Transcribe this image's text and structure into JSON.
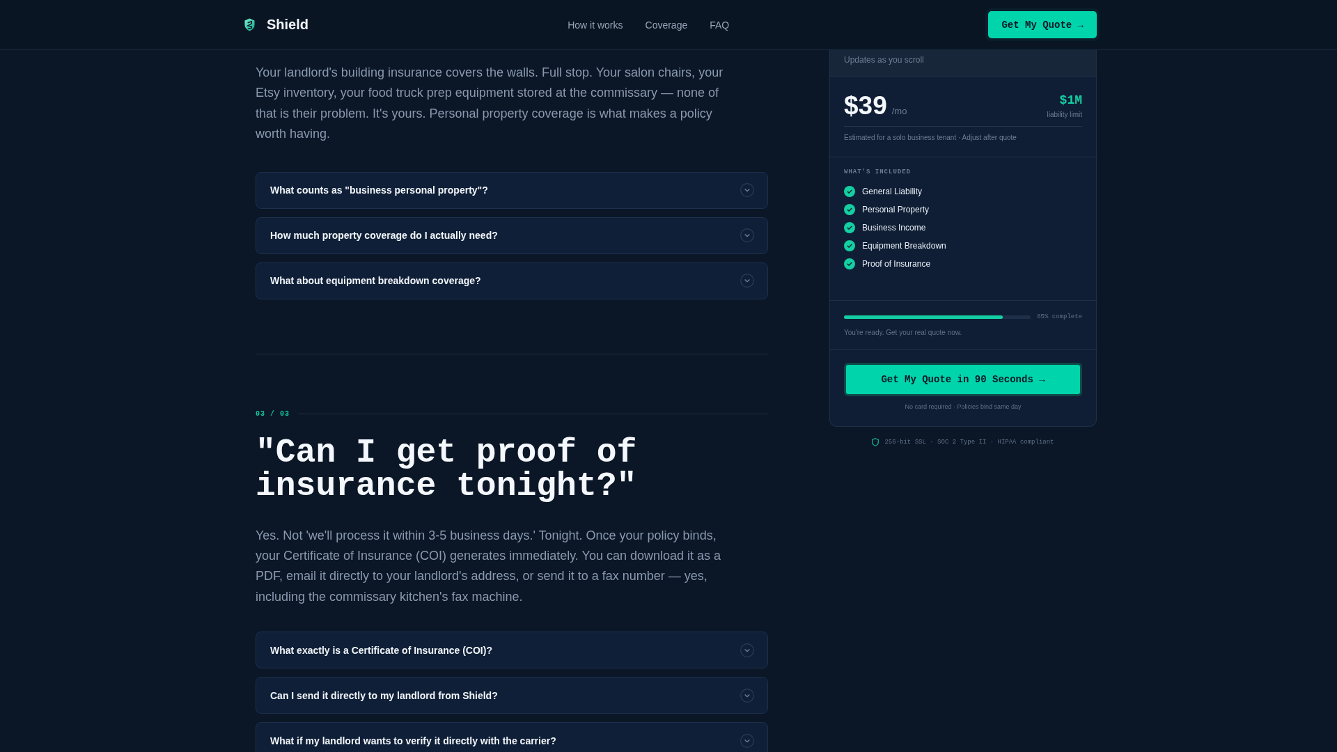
{
  "header": {
    "brand": "Shield",
    "nav": [
      {
        "label": "How it works"
      },
      {
        "label": "Coverage"
      },
      {
        "label": "FAQ"
      }
    ],
    "cta": "Get My Quote →"
  },
  "sections": [
    {
      "body": "Your landlord's building insurance covers the walls. Full stop. Your salon chairs, your Etsy inventory, your food truck prep equipment stored at the commissary — none of that is their problem. It's yours. Personal property coverage is what makes a policy worth having.",
      "faqs": [
        {
          "question": "What counts as \"business personal property\"?",
          "expanded": false
        },
        {
          "question": "How much property coverage do I actually need?",
          "expanded": false
        },
        {
          "question": "What about equipment breakdown coverage?",
          "expanded": false
        }
      ]
    },
    {
      "counter": "03 / 03",
      "title": "\"Can I get proof of insurance tonight?\"",
      "body": "Yes. Not 'we'll process it within 3-5 business days.' Tonight. Once your policy binds, your Certificate of Insurance (COI) generates immediately. You can download it as a PDF, email it directly to your landlord's address, or send it to a fax number — yes, including the commissary kitchen's fax machine.",
      "faqs": [
        {
          "question": "What exactly is a Certificate of Insurance (COI)?",
          "expanded": false
        },
        {
          "question": "Can I send it directly to my landlord from Shield?",
          "expanded": false
        },
        {
          "question": "What if my landlord wants to verify it directly with the carrier?",
          "expanded": false
        }
      ]
    }
  ],
  "quote_card": {
    "subtitle": "Updates as you scroll",
    "price": "$39",
    "period": "/mo",
    "limit": "$1M",
    "limit_label": "liability limit",
    "note": "Estimated for a solo business tenant · Adjust after quote",
    "included_label": "WHAT'S INCLUDED",
    "included": [
      {
        "label": "General Liability",
        "checked": true
      },
      {
        "label": "Personal Property",
        "checked": true
      },
      {
        "label": "Business Income",
        "checked": true
      },
      {
        "label": "Equipment Breakdown",
        "checked": true
      },
      {
        "label": "Proof of Insurance",
        "checked": true
      }
    ],
    "progress": {
      "level": 0.85,
      "reading": "85% complete",
      "message": "You're ready. Get your real quote now."
    },
    "cta": "Get My Quote in 90 Seconds →",
    "cta_note": "No card required · Policies bind same day"
  },
  "trust_line": "256-bit SSL · SOC 2 Type II · HIPAA compliant"
}
